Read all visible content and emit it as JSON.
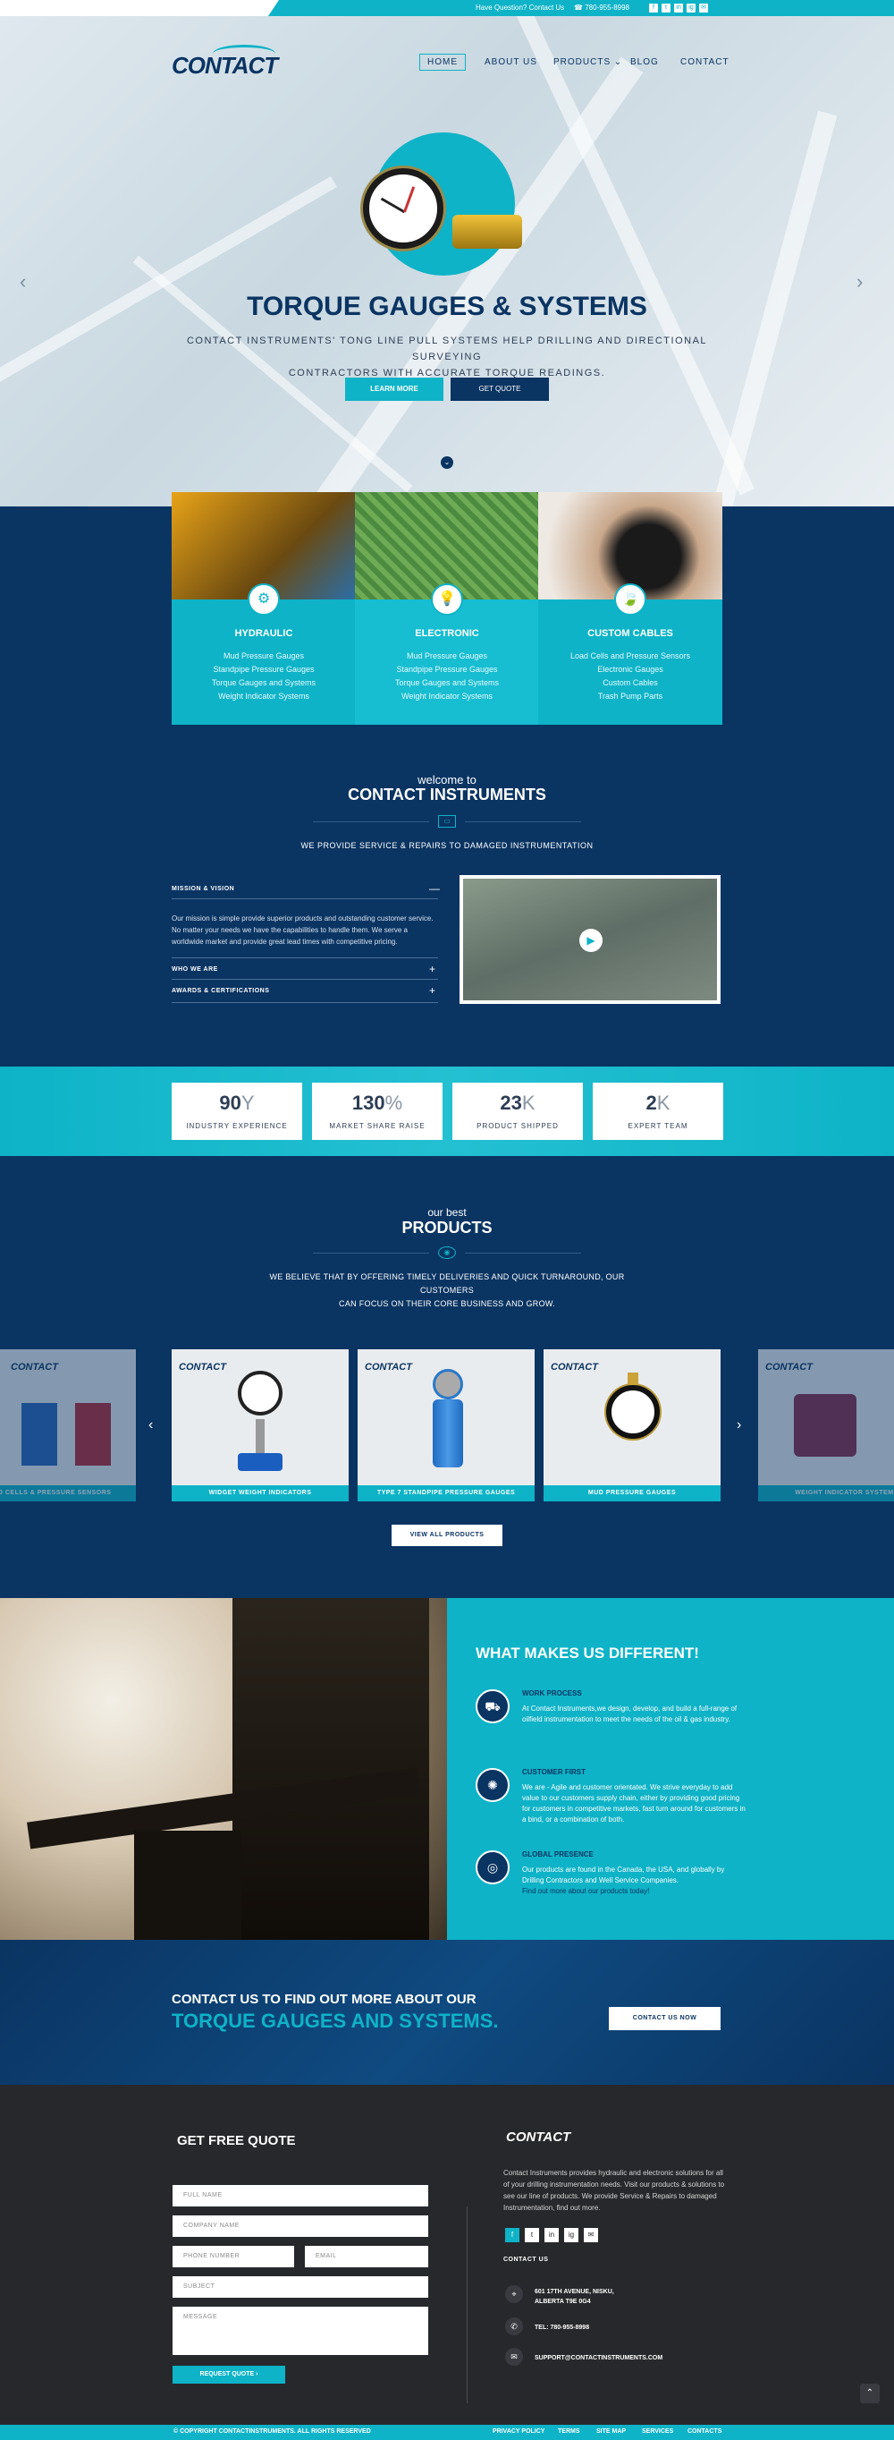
{
  "topbar": {
    "question": "Have Question? Contact Us",
    "phone": "780-955-8998",
    "social": [
      "f",
      "t",
      "in",
      "ig",
      "✉"
    ]
  },
  "header": {
    "logo": "CONTACT",
    "nav": [
      "HOME",
      "ABOUT US",
      "PRODUCTS",
      "BLOG",
      "CONTACT"
    ]
  },
  "hero": {
    "title": "TORQUE GAUGES & SYSTEMS",
    "subtitle_line1": "CONTACT INSTRUMENTS' TONG LINE PULL SYSTEMS HELP DRILLING AND DIRECTIONAL SURVEYING",
    "subtitle_line2": "CONTRACTORS WITH ACCURATE TORQUE READINGS.",
    "learn_more": "LEARN MORE",
    "get_quote": "GET QUOTE"
  },
  "services": [
    {
      "title": "HYDRAULIC",
      "items": [
        "Mud Pressure Gauges",
        "Standpipe Pressure Gauges",
        "Torque Gauges and Systems",
        "Weight Indicator Systems"
      ]
    },
    {
      "title": "ELECTRONIC",
      "items": [
        "Mud Pressure Gauges",
        "Standpipe Pressure Gauges",
        "Torque Gauges and Systems",
        "Weight Indicator Systems"
      ]
    },
    {
      "title": "CUSTOM CABLES",
      "items": [
        "Load Cells and Pressure Sensors",
        "Electronic Gauges",
        "Custom Cables",
        "Trash Pump Parts"
      ]
    }
  ],
  "welcome": {
    "small": "welcome to",
    "title": "CONTACT INSTRUMENTS",
    "tagline": "WE PROVIDE SERVICE & REPAIRS TO DAMAGED INSTRUMENTATION",
    "accordion": [
      {
        "title": "MISSION & VISION",
        "sign": "—"
      },
      {
        "title": "WHO WE ARE",
        "sign": "+"
      },
      {
        "title": "AWARDS & CERTIFICATIONS",
        "sign": "+"
      }
    ],
    "mission_text": "Our mission is simple provide superior products and outstanding customer service. No matter your needs we have the capabilities to handle them. We serve a worldwide market and provide great lead times with competitive pricing."
  },
  "stats": [
    {
      "num": "90",
      "suffix": "Y",
      "label": "INDUSTRY EXPERIENCE"
    },
    {
      "num": "130",
      "suffix": "%",
      "label": "MARKET SHARE RAISE"
    },
    {
      "num": "23",
      "suffix": "K",
      "label": "PRODUCT SHIPPED"
    },
    {
      "num": "2",
      "suffix": "K",
      "label": "EXPERT TEAM"
    }
  ],
  "products": {
    "small": "our best",
    "title": "PRODUCTS",
    "desc_line1": "WE BELIEVE THAT BY OFFERING TIMELY DELIVERIES AND QUICK TURNAROUND, OUR CUSTOMERS",
    "desc_line2": "CAN FOCUS ON THEIR CORE BUSINESS AND GROW.",
    "items": [
      "LOAD CELLS & PRESSURE SENSORS",
      "WIDGET WEIGHT INDICATORS",
      "TYPE 7 STANDPIPE PRESSURE GAUGES",
      "MUD PRESSURE GAUGES",
      "WEIGHT INDICATOR SYSTEMS"
    ],
    "view_all": "VIEW ALL PRODUCTS"
  },
  "different": {
    "title": "WHAT MAKES US DIFFERENT!",
    "features": [
      {
        "title": "WORK PROCESS",
        "text": "At Contact Instruments,we design, develop, and build a full-range of oilfield instrumentation to meet the needs of the oil & gas industry."
      },
      {
        "title": "CUSTOMER FIRST",
        "text": "We are - Agile and customer orientated. We strive everyday to add value to our customers supply chain, either by providing good pricing for customers in competitive markets, fast turn around for customers in a bind, or a combination of both."
      },
      {
        "title": "GLOBAL PRESENCE",
        "text": "Our products are found in the Canada, the USA, and globally by Drilling Contractors and Well Service Companies.",
        "link": "Find out more about our products today!"
      }
    ]
  },
  "cta": {
    "line1": "CONTACT US TO FIND OUT MORE ABOUT OUR",
    "line2": "TORQUE GAUGES AND SYSTEMS.",
    "button": "CONTACT US NOW"
  },
  "footer": {
    "quote_title": "GET FREE QUOTE",
    "placeholders": {
      "full_name": "FULL NAME",
      "company": "COMPANY NAME",
      "phone": "PHONE NUMBER",
      "email": "EMAIL",
      "subject": "SUBJECT",
      "message": "MESSAGE"
    },
    "request": "REQUEST QUOTE   ›",
    "logo": "CONTACT",
    "desc": "Contact Instruments provides hydraulic and electronic solutions for all of your drilling instrumentation needs. Visit our products & solutions to see our line of products. We provide Service & Repairs to damaged Instrumentation, find out more.",
    "social": [
      "f",
      "t",
      "in",
      "ig",
      "✉"
    ],
    "contact_title": "CONTACT US",
    "address1": "601 17TH AVENUE, NISKU,",
    "address2": "ALBERTA T9E 0G4",
    "phone": "TEL: 780-955-8998",
    "email": "SUPPORT@CONTACTINSTRUMENTS.COM"
  },
  "bottom": {
    "copyright": "© COPYRIGHT CONTACTINSTRUMENTS. ALL RIGHTS RESERVED",
    "links": [
      "PRIVACY POLICY",
      "TERMS",
      "SITE MAP",
      "SERVICES",
      "CONTACTS"
    ]
  }
}
